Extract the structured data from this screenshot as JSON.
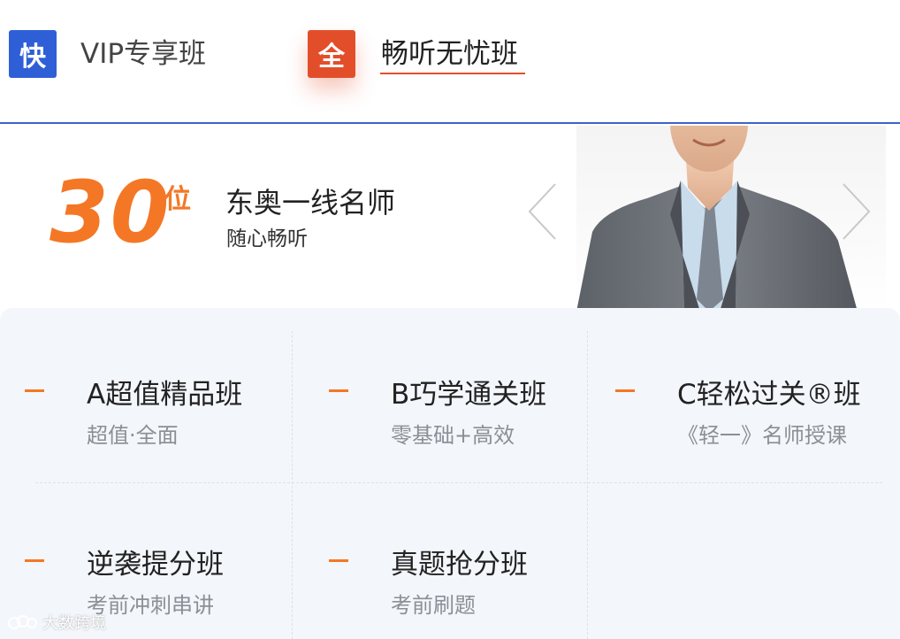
{
  "tabs": [
    {
      "badge": "快",
      "label": "VIP专享班",
      "active": false
    },
    {
      "badge": "全",
      "label": "畅听无忧班",
      "active": true
    }
  ],
  "hero": {
    "count": "30",
    "count_unit": "位",
    "title": "东奥一线名师",
    "subtitle": "随心畅听"
  },
  "classes": [
    {
      "title": "A超值精品班",
      "subtitle": "超值·全面"
    },
    {
      "title": "B巧学通关班",
      "subtitle": "零基础+高效"
    },
    {
      "title": "C轻松过关®班",
      "subtitle": "《轻一》名师授课"
    },
    {
      "title": "逆袭提分班",
      "subtitle": "考前冲刺串讲"
    },
    {
      "title": "真题抢分班",
      "subtitle": "考前刷题"
    }
  ],
  "watermark": "大数跨境",
  "colors": {
    "accent_orange": "#f47726",
    "badge_blue": "#2f5fd7",
    "badge_red": "#e34e2a",
    "tab_border": "#3e63c8"
  }
}
